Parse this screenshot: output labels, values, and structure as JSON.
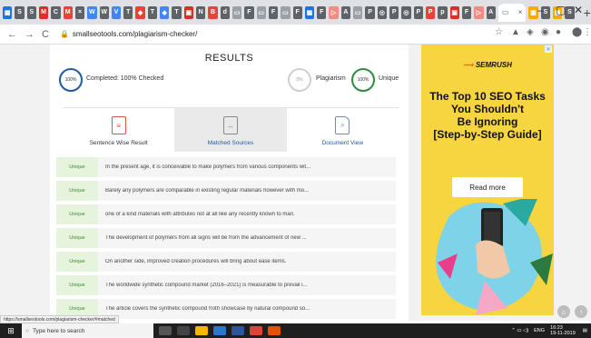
{
  "browser": {
    "tabs": [
      {
        "color": "#1a73e8",
        "glyph": "▦"
      },
      {
        "color": "#5f6368",
        "glyph": "S"
      },
      {
        "color": "#5f6368",
        "glyph": "S"
      },
      {
        "color": "#d93025",
        "glyph": "M"
      },
      {
        "color": "#5f6368",
        "glyph": "C"
      },
      {
        "color": "#ea4335",
        "glyph": "M"
      },
      {
        "color": "#5f6368",
        "glyph": "×"
      },
      {
        "color": "#4285f4",
        "glyph": "W"
      },
      {
        "color": "#5f6368",
        "glyph": "W"
      },
      {
        "color": "#4285f4",
        "glyph": "V"
      },
      {
        "color": "#5f6368",
        "glyph": "T"
      },
      {
        "color": "#ea4335",
        "glyph": "◆"
      },
      {
        "color": "#5f6368",
        "glyph": "T"
      },
      {
        "color": "#4285f4",
        "glyph": "◆"
      },
      {
        "color": "#5f6368",
        "glyph": "T"
      },
      {
        "color": "#d93025",
        "glyph": "▣"
      },
      {
        "color": "#5f6368",
        "glyph": "N"
      },
      {
        "color": "#ea4335",
        "glyph": "B"
      },
      {
        "color": "#5f6368",
        "glyph": "d"
      },
      {
        "color": "#9aa0a6",
        "glyph": "▭"
      },
      {
        "color": "#5f6368",
        "glyph": "F"
      },
      {
        "color": "#9aa0a6",
        "glyph": "▭"
      },
      {
        "color": "#5f6368",
        "glyph": "F"
      },
      {
        "color": "#9aa0a6",
        "glyph": "▭"
      },
      {
        "color": "#5f6368",
        "glyph": "F"
      },
      {
        "color": "#1a73e8",
        "glyph": "▦"
      },
      {
        "color": "#5f6368",
        "glyph": "F"
      },
      {
        "color": "#f28b82",
        "glyph": "▷"
      },
      {
        "color": "#5f6368",
        "glyph": "A"
      },
      {
        "color": "#9aa0a6",
        "glyph": "▭"
      },
      {
        "color": "#5f6368",
        "glyph": "P"
      },
      {
        "color": "#5f6368",
        "glyph": "◎"
      },
      {
        "color": "#5f6368",
        "glyph": "P"
      },
      {
        "color": "#5f6368",
        "glyph": "◎"
      },
      {
        "color": "#5f6368",
        "glyph": "P"
      },
      {
        "color": "#ea4335",
        "glyph": "P"
      },
      {
        "color": "#5f6368",
        "glyph": "p"
      },
      {
        "color": "#d93025",
        "glyph": "▣"
      },
      {
        "color": "#5f6368",
        "glyph": "F"
      },
      {
        "color": "#f28b82",
        "glyph": "▷"
      },
      {
        "color": "#5f6368",
        "glyph": "A"
      }
    ],
    "active_tab_close": "×",
    "after_tabs": [
      {
        "color": "#f9ab00",
        "glyph": "▦"
      },
      {
        "color": "#5f6368",
        "glyph": "S"
      },
      {
        "color": "#f9ab00",
        "glyph": "▦"
      },
      {
        "color": "#5f6368",
        "glyph": "S"
      }
    ],
    "new_tab": "+",
    "minimize": "–",
    "restore": "▢",
    "close": "✕",
    "back": "←",
    "forward": "→",
    "reload": "C",
    "url": "smallseotools.com/plagiarism-checker/",
    "status_url": "https://smallseotools.com/plagiarism-checker/#matched"
  },
  "results": {
    "title": "RESULTS",
    "completed_pct": "100%",
    "completed_label": "Completed: 100% Checked",
    "plagiarism_pct": "0%",
    "plagiarism_label": "Plagiarism",
    "unique_pct": "100%",
    "unique_label": "Unique"
  },
  "tabs": {
    "sentence": "Sentence Wise Result",
    "matched": "Matched Sources",
    "document": "Document View"
  },
  "rows": [
    {
      "badge": "Unique",
      "text": "In the present age, it is conceivable to make polymers from various components wit..."
    },
    {
      "badge": "Unique",
      "text": "Barely any polymers are comparable in existing regular materials however with mo..."
    },
    {
      "badge": "Unique",
      "text": "one of a kind materials with attributes not at all like any recently known to man."
    },
    {
      "badge": "Unique",
      "text": "The development of polymers from all signs will be from the advancement of new ..."
    },
    {
      "badge": "Unique",
      "text": "On another side, improved creation procedures will bring about ease items."
    },
    {
      "badge": "Unique",
      "text": "The worldwide synthetic compound market (2016–2021) is measurable to prevail i..."
    },
    {
      "badge": "Unique",
      "text": "The article covers the synthetic compound froth showcase by natural compound so..."
    }
  ],
  "ad": {
    "close": "✕",
    "brand": "SEMRUSH",
    "headline_lines": [
      "The Top 10 SEO Tasks",
      "You Shouldn't",
      "Be Ignoring",
      "[Step-by-Step Guide]"
    ],
    "button": "Read more"
  },
  "taskbar": {
    "search_placeholder": "Type here to search",
    "lang": "ENG",
    "time": "16:23",
    "date": "19-11-2019"
  }
}
